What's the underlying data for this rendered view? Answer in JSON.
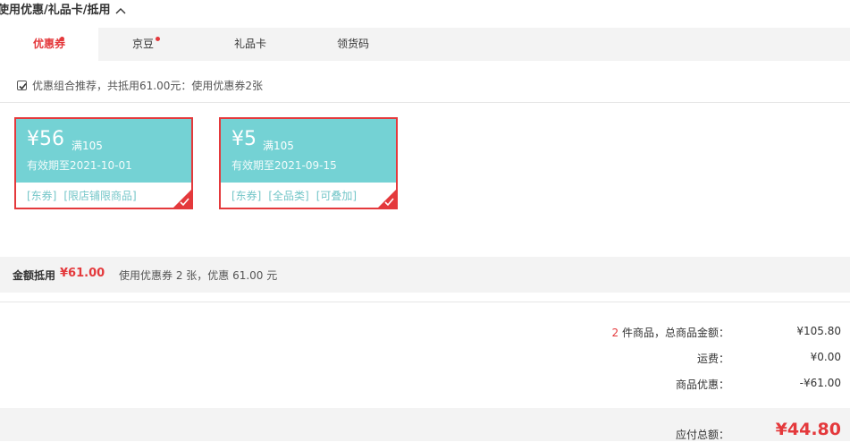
{
  "section": {
    "title": "使用优惠/礼品卡/抵用"
  },
  "tabs": [
    {
      "label": "优惠券",
      "active": true,
      "has_dot": true
    },
    {
      "label": "京豆",
      "active": false,
      "has_dot": true
    },
    {
      "label": "礼品卡",
      "active": false,
      "has_dot": false
    },
    {
      "label": "领货码",
      "active": false,
      "has_dot": false
    }
  ],
  "recommend": {
    "checked": true,
    "text": "优惠组合推荐，共抵用61.00元：使用优惠券2张"
  },
  "coupons": [
    {
      "amount": "¥56",
      "condition": "满105",
      "expiry": "有效期至2021-10-01",
      "tags": [
        "[东券]",
        "[限店铺限商品]"
      ],
      "selected": true
    },
    {
      "amount": "¥5",
      "condition": "满105",
      "expiry": "有效期至2021-09-15",
      "tags": [
        "[东券]",
        "[全品类]",
        "[可叠加]"
      ],
      "selected": true
    }
  ],
  "summary": {
    "label": "金额抵用",
    "amount": "¥61.00",
    "desc": "使用优惠券 2 张，优惠 61.00 元"
  },
  "totals": {
    "count": "2",
    "items_label": " 件商品，总商品金额：",
    "items_value": "¥105.80",
    "shipping_label": "运费：",
    "shipping_value": "¥0.00",
    "discount_label": "商品优惠：",
    "discount_value": "-¥61.00",
    "payable_label": "应付总额：",
    "payable_value": "¥44.80"
  },
  "colors": {
    "accent": "#e4393c",
    "coupon_bg": "#74d2d4",
    "tab_bg": "#f3f3f3"
  }
}
